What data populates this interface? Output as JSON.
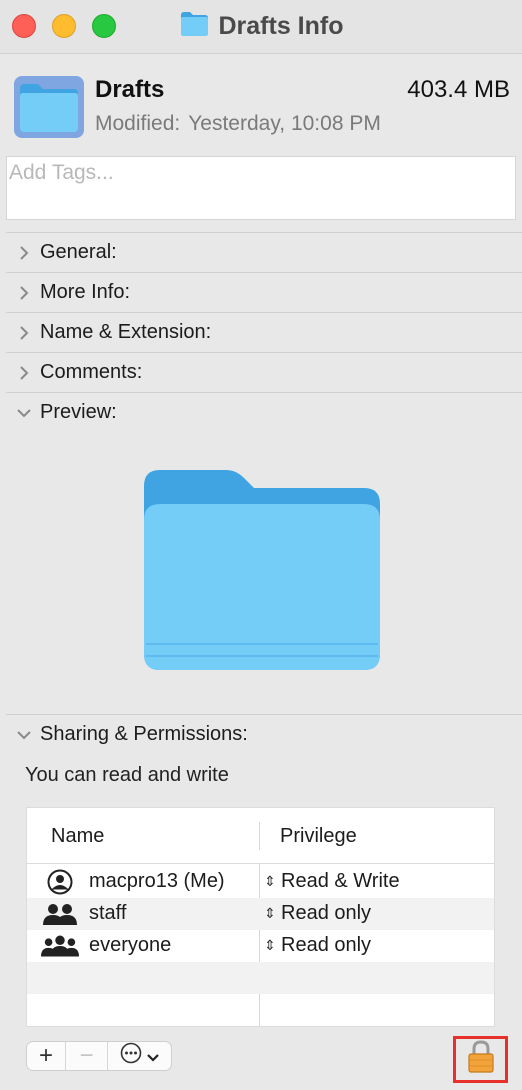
{
  "window": {
    "title": "Drafts Info"
  },
  "header": {
    "name": "Drafts",
    "size": "403.4 MB",
    "modified_label": "Modified:",
    "modified_value": "Yesterday, 10:08 PM"
  },
  "tags": {
    "placeholder": "Add Tags..."
  },
  "sections": {
    "general": "General:",
    "more_info": "More Info:",
    "name_extension": "Name & Extension:",
    "comments": "Comments:",
    "preview": "Preview:",
    "sharing": "Sharing & Permissions:"
  },
  "permissions": {
    "note": "You can read and write",
    "columns": {
      "name": "Name",
      "privilege": "Privilege"
    },
    "rows": [
      {
        "name": "macpro13 (Me)",
        "privilege": "Read & Write",
        "icon": "user-circle-icon"
      },
      {
        "name": "staff",
        "privilege": "Read only",
        "icon": "two-users-icon"
      },
      {
        "name": "everyone",
        "privilege": "Read only",
        "icon": "three-users-icon"
      }
    ]
  },
  "toolbar": {
    "add": "+",
    "remove": "−"
  },
  "colors": {
    "folder_light": "#74cdf6",
    "folder_dark": "#3fa4e1",
    "highlight": "#e8302b",
    "lock": "#f2a33a"
  }
}
